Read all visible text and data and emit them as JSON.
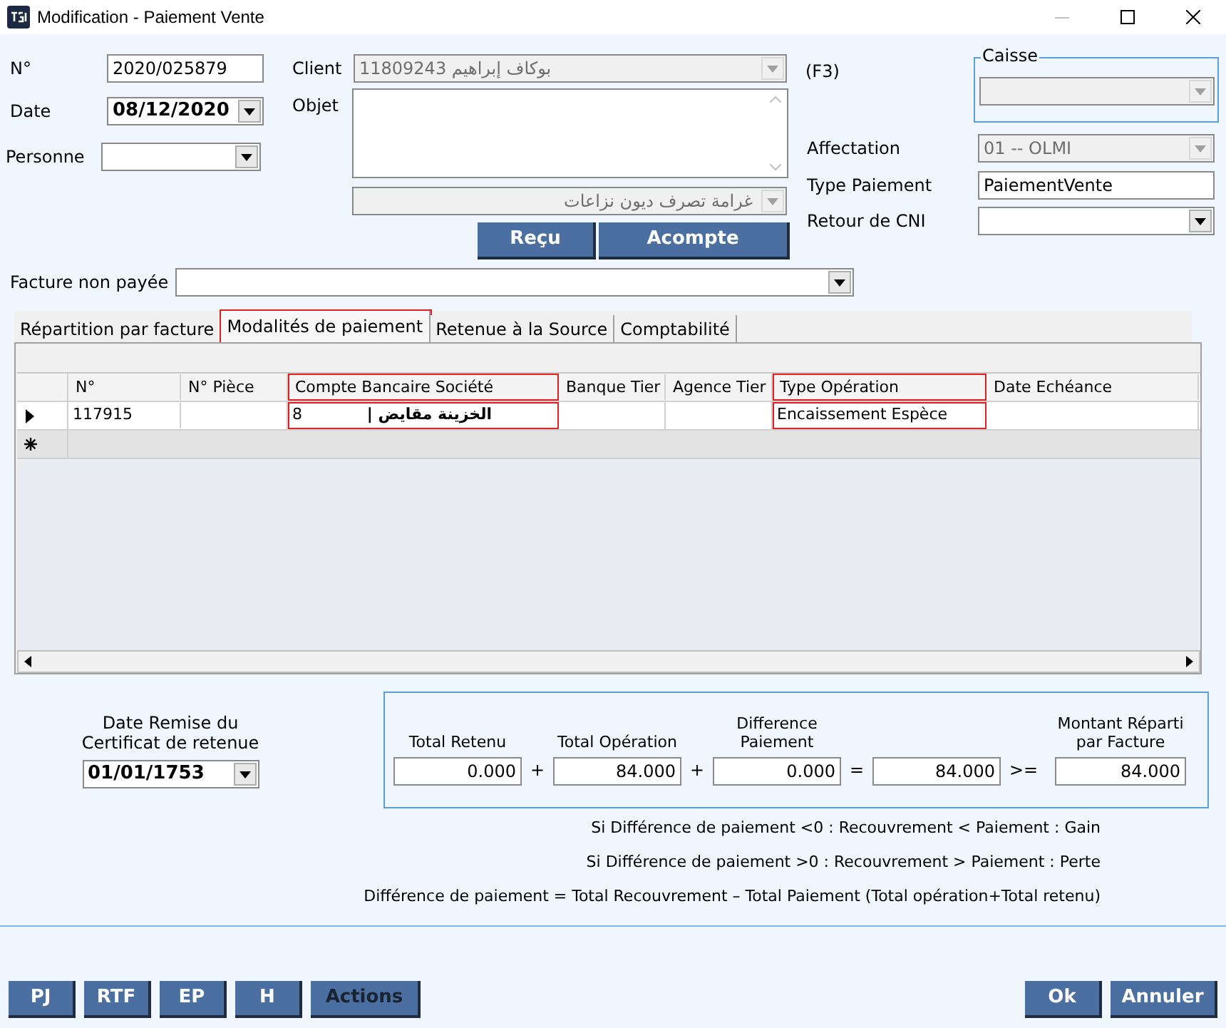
{
  "window": {
    "title": "Modification - Paiement Vente"
  },
  "header": {
    "number": {
      "label": "N°",
      "value": "2020/025879"
    },
    "date": {
      "label": "Date",
      "value": "08/12/2020"
    },
    "person": {
      "label": "Personne"
    },
    "client": {
      "label": "Client",
      "value": "11809243 بوكاف إبراهيم",
      "shortcut": "(F3)"
    },
    "object": {
      "label": "Objet"
    },
    "object_category": {
      "value": "غرامة تصرف ديون نزاعات"
    },
    "buttons": [
      "Reçu",
      "Acompte"
    ],
    "cash_box": {
      "legend": "Caisse"
    },
    "assignment": {
      "label": "Affectation",
      "value": "01 -- OLMI"
    },
    "payment_type": {
      "label": "Type Paiement",
      "value": "PaiementVente"
    },
    "id_return": {
      "label": "Retour de CNI"
    },
    "unpaid_invoice": {
      "label": "Facture non payée"
    }
  },
  "tabs": [
    {
      "label": "Répartition par facture",
      "selected": false,
      "highlighted": false
    },
    {
      "label": "Modalités de paiement",
      "selected": true,
      "highlighted": true
    },
    {
      "label": "Retenue à la Source",
      "selected": false,
      "highlighted": false
    },
    {
      "label": "Comptabilité",
      "selected": false,
      "highlighted": false
    }
  ],
  "grid": {
    "columns": [
      {
        "label": "N°",
        "highlighted": false
      },
      {
        "label": "N° Pièce",
        "highlighted": false
      },
      {
        "label": "Compte Bancaire Société",
        "highlighted": true
      },
      {
        "label": "Banque Tier",
        "highlighted": false
      },
      {
        "label": "Agence Tier",
        "highlighted": false
      },
      {
        "label": "Type Opération",
        "highlighted": true
      },
      {
        "label": "Date Echéance",
        "highlighted": false
      }
    ],
    "rows": [
      {
        "current": true,
        "cells": [
          {
            "value": "117915"
          },
          {},
          {
            "value": "8",
            "extra": "الخزينة مقايض |"
          },
          {},
          {},
          {
            "value": "Encaissement Espèce"
          },
          {}
        ]
      }
    ]
  },
  "certificate": {
    "label": "Date Remise du Certificat de retenue",
    "value": "01/01/1753"
  },
  "totals": [
    {
      "label": "Total Retenu",
      "value": "0.000",
      "operator": "+"
    },
    {
      "label": "Total Opération",
      "value": "84.000",
      "operator": "+"
    },
    {
      "label": "Difference Paiement",
      "value": "0.000",
      "operator": "="
    },
    {
      "value": "84.000",
      "operator": ">="
    },
    {
      "label": "Montant Réparti par Facture",
      "value": "84.000"
    }
  ],
  "notes": [
    "Si Différence de paiement <0 : Recouvrement < Paiement : Gain",
    "Si Différence de paiement >0 : Recouvrement > Paiement : Perte",
    "Différence de paiement = Total Recouvrement – Total Paiement (Total opération+Total retenu)"
  ],
  "footer": {
    "left_buttons": [
      {
        "label": "PJ",
        "disabled": false
      },
      {
        "label": "RTF",
        "disabled": false
      },
      {
        "label": "EP",
        "disabled": false
      },
      {
        "label": "H",
        "disabled": false
      },
      {
        "label": "Actions",
        "disabled": true
      }
    ],
    "right_buttons": [
      "Ok",
      "Annuler"
    ]
  }
}
